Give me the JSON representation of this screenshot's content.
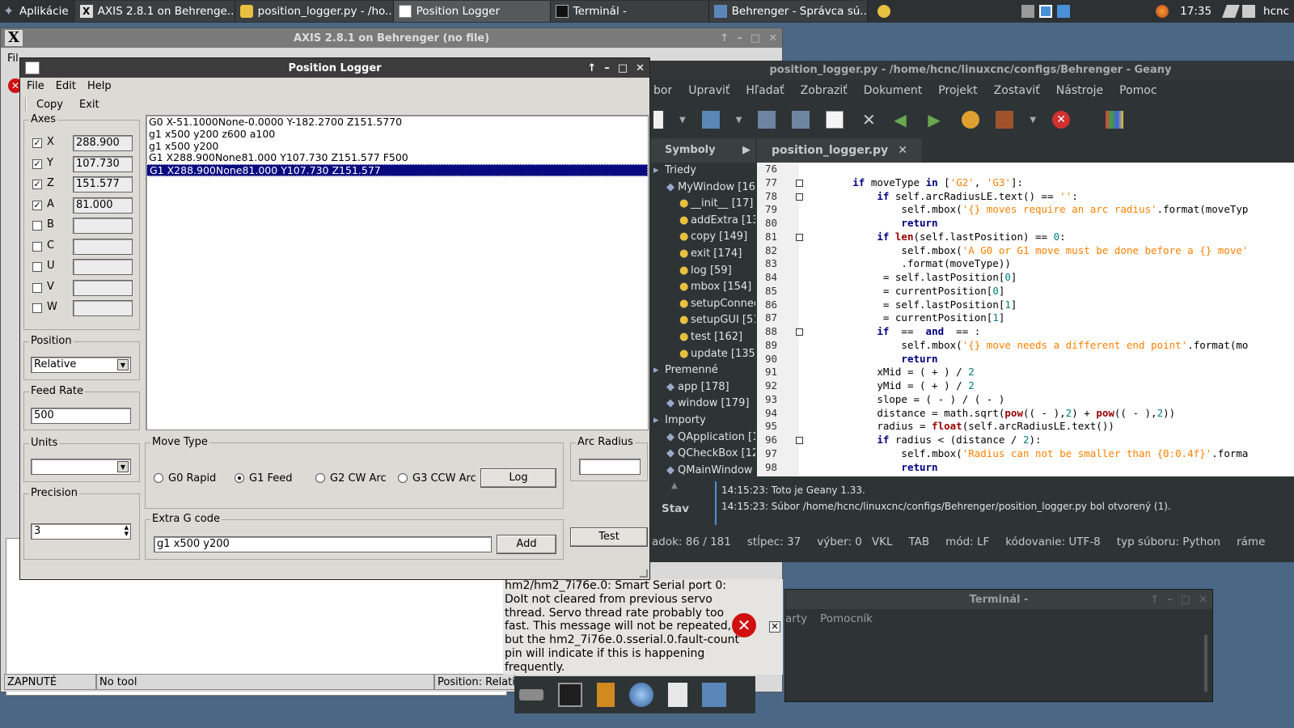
{
  "taskbar": {
    "start_label": "Aplikácie",
    "tasks": [
      {
        "label": "AXIS 2.8.1 on Behrenge..."
      },
      {
        "label": "position_logger.py - /ho..."
      },
      {
        "label": "Position Logger"
      },
      {
        "label": "Terminál -"
      },
      {
        "label": "Behrenger - Správca sú..."
      }
    ],
    "clock": "17:35",
    "user": "hcnc"
  },
  "axis_window": {
    "title": "AXIS 2.8.1 on Behrenger (no file)",
    "status": [
      "ZAPNUTÉ",
      "No tool",
      "Position: Relati"
    ]
  },
  "geany": {
    "title": "position_logger.py - /home/hcnc/linuxcnc/configs/Behrenger - Geany",
    "menu": [
      "bor",
      "Upraviť",
      "Hľadať",
      "Zobraziť",
      "Dokument",
      "Projekt",
      "Zostaviť",
      "Nástroje",
      "Pomoc"
    ],
    "side_tab": "Symboly",
    "tree": [
      {
        "label": "Triedy",
        "indent": 0
      },
      {
        "label": "MyWindow [16]",
        "indent": 1
      },
      {
        "label": "__init__ [17]",
        "indent": 2
      },
      {
        "label": "addExtra [132",
        "indent": 2
      },
      {
        "label": "copy [149]",
        "indent": 2
      },
      {
        "label": "exit [174]",
        "indent": 2
      },
      {
        "label": "log [59]",
        "indent": 2
      },
      {
        "label": "mbox [154]",
        "indent": 2
      },
      {
        "label": "setupConnect",
        "indent": 2
      },
      {
        "label": "setupGUI [51",
        "indent": 2
      },
      {
        "label": "test [162]",
        "indent": 2
      },
      {
        "label": "update [135]",
        "indent": 2
      },
      {
        "label": "Premenné",
        "indent": 0
      },
      {
        "label": "app [178]",
        "indent": 1
      },
      {
        "label": "window [179]",
        "indent": 1
      },
      {
        "label": "Importy",
        "indent": 0
      },
      {
        "label": "QApplication [12",
        "indent": 1
      },
      {
        "label": "QCheckBox [12]",
        "indent": 1
      },
      {
        "label": "QMainWindow [1",
        "indent": 1
      }
    ],
    "editor_tab": "position_logger.py",
    "line_numbers": [
      "76",
      "77",
      "78",
      "79",
      "80",
      "81",
      "82",
      "83",
      "84",
      "85",
      "86",
      "87",
      "88",
      "89",
      "90",
      "91",
      "92",
      "93",
      "94",
      "95",
      "96",
      "97",
      "98"
    ],
    "code_lines": [
      "",
      "        if moveType in ['G2', 'G3']:",
      "            if self.arcRadiusLE.text() == '':",
      "                self.mbox('{} moves require an arc radius'.format(moveTyp",
      "                return",
      "            if len(self.lastPosition) == 0:",
      "                self.mbox('A G0 or G1 move must be done before a {} move'",
      "                .format(moveType))",
      "            x1 = self.lastPosition[0]",
      "            x2 = currentPosition[0]",
      "            y1 = self.lastPosition[1]",
      "            y2 = currentPosition[1]",
      "            if x1 == x2 and y1 == y2:",
      "                self.mbox('{} move needs a different end point'.format(mo",
      "                return",
      "            xMid = (x1 + x2) / 2",
      "            yMid = (y1 + y2) / 2",
      "            slope = (y2 - y1) / (x2 - x1)",
      "            distance = math.sqrt(pow((x1 - x2),2) + pow((y1 - y2),2))",
      "            radius = float(self.arcRadiusLE.text())",
      "            if radius < (distance / 2):",
      "                self.mbox('Radius can not be smaller than {0:0.4f}'.forma",
      "                return"
    ],
    "msg_tab": "Stav",
    "messages": [
      "14:15:23: Toto je Geany 1.33.",
      "14:15:23: Súbor /home/hcnc/linuxcnc/configs/Behrenger/position_logger.py bol otvorený (1)."
    ],
    "status": [
      "adok: 86 / 181",
      "stĺpec: 37",
      "výber: 0",
      "VKL",
      "TAB",
      "mód: LF",
      "kódovanie: UTF-8",
      "typ súboru: Python",
      "ráme"
    ]
  },
  "terminal": {
    "title": "Terminál -",
    "menu": [
      "arty",
      "Pomocník"
    ]
  },
  "notification": {
    "text": "hm2/hm2_7i76e.0: Smart Serial port 0: DoIt not cleared from previous servo thread. Servo thread rate probably too fast. This message will not be repeated, but the hm2_7i76e.0.sserial.0.fault-count pin will indicate if this is happening frequently."
  },
  "plogger": {
    "title": "Position Logger",
    "menu": [
      "File",
      "Edit",
      "Help"
    ],
    "toolbar": [
      "Copy",
      "Exit"
    ],
    "axes_title": "Axes",
    "axes": [
      {
        "name": "X",
        "checked": true,
        "value": "288.900"
      },
      {
        "name": "Y",
        "checked": true,
        "value": "107.730"
      },
      {
        "name": "Z",
        "checked": true,
        "value": "151.577"
      },
      {
        "name": "A",
        "checked": true,
        "value": "81.000"
      },
      {
        "name": "B",
        "checked": false,
        "value": ""
      },
      {
        "name": "C",
        "checked": false,
        "value": ""
      },
      {
        "name": "U",
        "checked": false,
        "value": ""
      },
      {
        "name": "V",
        "checked": false,
        "value": ""
      },
      {
        "name": "W",
        "checked": false,
        "value": ""
      }
    ],
    "position_title": "Position",
    "position_value": "Relative",
    "feed_title": "Feed Rate",
    "feed_value": "500",
    "units_title": "Units",
    "units_value": "",
    "precision_title": "Precision",
    "precision_value": "3",
    "log_lines": [
      "G0  X-51.1000None-0.0000 Y-182.2700 Z151.5770",
      "g1 x500 y200 z600 a100",
      "g1 x500 y200",
      "G1  X288.900None81.000 Y107.730 Z151.577 F500",
      "G1  X288.900None81.000 Y107.730 Z151.577"
    ],
    "selected_index": 4,
    "move_type_title": "Move Type",
    "move_types": [
      {
        "label": "G0 Rapid",
        "selected": false
      },
      {
        "label": "G1 Feed",
        "selected": true
      },
      {
        "label": "G2 CW Arc",
        "selected": false
      },
      {
        "label": "G3 CCW Arc",
        "selected": false
      }
    ],
    "log_button": "Log",
    "arc_title": "Arc Radius",
    "arc_value": "",
    "extra_title": "Extra G code",
    "extra_value": "g1 x500 y200",
    "add_button": "Add",
    "test_button": "Test"
  },
  "colors": {
    "desktop": "#4a6786",
    "selection": "#0a0a80",
    "geany_bg": "#2e3436"
  }
}
